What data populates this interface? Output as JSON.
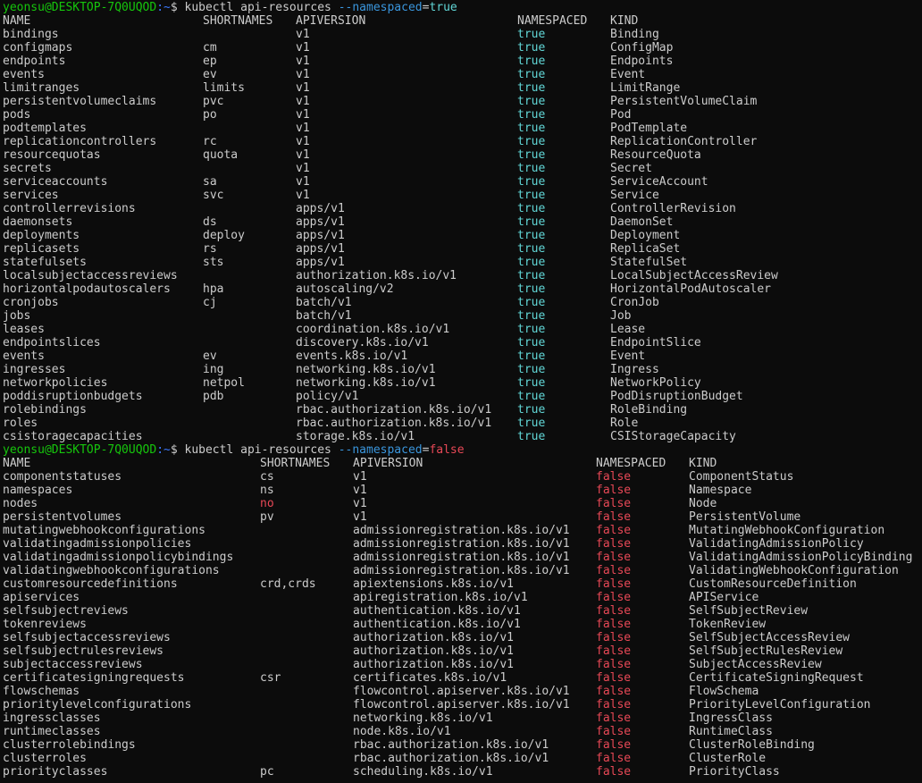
{
  "colors": {
    "green": "#16c60c",
    "red": "#e74856",
    "blue": "#3b78ff",
    "text": "#cccccc",
    "bg": "#0c0c0c"
  },
  "block1": {
    "prompt_user": "yeonsu@DESKTOP-7Q0UQOD",
    "prompt_path": ":~",
    "prompt_symbol": "$ ",
    "command": "kubectl api-resources ",
    "flag": "--namespaced",
    "flag_eq": "=",
    "flag_value": "true",
    "headers": [
      "NAME",
      "SHORTNAMES",
      "APIVERSION",
      "NAMESPACED",
      "KIND"
    ],
    "rows": [
      [
        "bindings",
        "",
        "v1",
        "true",
        "Binding"
      ],
      [
        "configmaps",
        "cm",
        "v1",
        "true",
        "ConfigMap"
      ],
      [
        "endpoints",
        "ep",
        "v1",
        "true",
        "Endpoints"
      ],
      [
        "events",
        "ev",
        "v1",
        "true",
        "Event"
      ],
      [
        "limitranges",
        "limits",
        "v1",
        "true",
        "LimitRange"
      ],
      [
        "persistentvolumeclaims",
        "pvc",
        "v1",
        "true",
        "PersistentVolumeClaim"
      ],
      [
        "pods",
        "po",
        "v1",
        "true",
        "Pod"
      ],
      [
        "podtemplates",
        "",
        "v1",
        "true",
        "PodTemplate"
      ],
      [
        "replicationcontrollers",
        "rc",
        "v1",
        "true",
        "ReplicationController"
      ],
      [
        "resourcequotas",
        "quota",
        "v1",
        "true",
        "ResourceQuota"
      ],
      [
        "secrets",
        "",
        "v1",
        "true",
        "Secret"
      ],
      [
        "serviceaccounts",
        "sa",
        "v1",
        "true",
        "ServiceAccount"
      ],
      [
        "services",
        "svc",
        "v1",
        "true",
        "Service"
      ],
      [
        "controllerrevisions",
        "",
        "apps/v1",
        "true",
        "ControllerRevision"
      ],
      [
        "daemonsets",
        "ds",
        "apps/v1",
        "true",
        "DaemonSet"
      ],
      [
        "deployments",
        "deploy",
        "apps/v1",
        "true",
        "Deployment"
      ],
      [
        "replicasets",
        "rs",
        "apps/v1",
        "true",
        "ReplicaSet"
      ],
      [
        "statefulsets",
        "sts",
        "apps/v1",
        "true",
        "StatefulSet"
      ],
      [
        "localsubjectaccessreviews",
        "",
        "authorization.k8s.io/v1",
        "true",
        "LocalSubjectAccessReview"
      ],
      [
        "horizontalpodautoscalers",
        "hpa",
        "autoscaling/v2",
        "true",
        "HorizontalPodAutoscaler"
      ],
      [
        "cronjobs",
        "cj",
        "batch/v1",
        "true",
        "CronJob"
      ],
      [
        "jobs",
        "",
        "batch/v1",
        "true",
        "Job"
      ],
      [
        "leases",
        "",
        "coordination.k8s.io/v1",
        "true",
        "Lease"
      ],
      [
        "endpointslices",
        "",
        "discovery.k8s.io/v1",
        "true",
        "EndpointSlice"
      ],
      [
        "events",
        "ev",
        "events.k8s.io/v1",
        "true",
        "Event"
      ],
      [
        "ingresses",
        "ing",
        "networking.k8s.io/v1",
        "true",
        "Ingress"
      ],
      [
        "networkpolicies",
        "netpol",
        "networking.k8s.io/v1",
        "true",
        "NetworkPolicy"
      ],
      [
        "poddisruptionbudgets",
        "pdb",
        "policy/v1",
        "true",
        "PodDisruptionBudget"
      ],
      [
        "rolebindings",
        "",
        "rbac.authorization.k8s.io/v1",
        "true",
        "RoleBinding"
      ],
      [
        "roles",
        "",
        "rbac.authorization.k8s.io/v1",
        "true",
        "Role"
      ],
      [
        "csistoragecapacities",
        "",
        "storage.k8s.io/v1",
        "true",
        "CSIStorageCapacity"
      ]
    ]
  },
  "block2": {
    "prompt_user": "yeonsu@DESKTOP-7Q0UQOD",
    "prompt_path": ":~",
    "prompt_symbol": "$ ",
    "command": "kubectl api-resources ",
    "flag": "--namespaced",
    "flag_eq": "=",
    "flag_value": "false",
    "headers": [
      "NAME",
      "SHORTNAMES",
      "APIVERSION",
      "NAMESPACED",
      "KIND"
    ],
    "rows": [
      [
        "componentstatuses",
        "cs",
        "v1",
        "false",
        "ComponentStatus"
      ],
      [
        "namespaces",
        "ns",
        "v1",
        "false",
        "Namespace"
      ],
      [
        "nodes",
        "no",
        "v1",
        "false",
        "Node"
      ],
      [
        "persistentvolumes",
        "pv",
        "v1",
        "false",
        "PersistentVolume"
      ],
      [
        "mutatingwebhookconfigurations",
        "",
        "admissionregistration.k8s.io/v1",
        "false",
        "MutatingWebhookConfiguration"
      ],
      [
        "validatingadmissionpolicies",
        "",
        "admissionregistration.k8s.io/v1",
        "false",
        "ValidatingAdmissionPolicy"
      ],
      [
        "validatingadmissionpolicybindings",
        "",
        "admissionregistration.k8s.io/v1",
        "false",
        "ValidatingAdmissionPolicyBinding"
      ],
      [
        "validatingwebhookconfigurations",
        "",
        "admissionregistration.k8s.io/v1",
        "false",
        "ValidatingWebhookConfiguration"
      ],
      [
        "customresourcedefinitions",
        "crd,crds",
        "apiextensions.k8s.io/v1",
        "false",
        "CustomResourceDefinition"
      ],
      [
        "apiservices",
        "",
        "apiregistration.k8s.io/v1",
        "false",
        "APIService"
      ],
      [
        "selfsubjectreviews",
        "",
        "authentication.k8s.io/v1",
        "false",
        "SelfSubjectReview"
      ],
      [
        "tokenreviews",
        "",
        "authentication.k8s.io/v1",
        "false",
        "TokenReview"
      ],
      [
        "selfsubjectaccessreviews",
        "",
        "authorization.k8s.io/v1",
        "false",
        "SelfSubjectAccessReview"
      ],
      [
        "selfsubjectrulesreviews",
        "",
        "authorization.k8s.io/v1",
        "false",
        "SelfSubjectRulesReview"
      ],
      [
        "subjectaccessreviews",
        "",
        "authorization.k8s.io/v1",
        "false",
        "SubjectAccessReview"
      ],
      [
        "certificatesigningrequests",
        "csr",
        "certificates.k8s.io/v1",
        "false",
        "CertificateSigningRequest"
      ],
      [
        "flowschemas",
        "",
        "flowcontrol.apiserver.k8s.io/v1",
        "false",
        "FlowSchema"
      ],
      [
        "prioritylevelconfigurations",
        "",
        "flowcontrol.apiserver.k8s.io/v1",
        "false",
        "PriorityLevelConfiguration"
      ],
      [
        "ingressclasses",
        "",
        "networking.k8s.io/v1",
        "false",
        "IngressClass"
      ],
      [
        "runtimeclasses",
        "",
        "node.k8s.io/v1",
        "false",
        "RuntimeClass"
      ],
      [
        "clusterrolebindings",
        "",
        "rbac.authorization.k8s.io/v1",
        "false",
        "ClusterRoleBinding"
      ],
      [
        "clusterroles",
        "",
        "rbac.authorization.k8s.io/v1",
        "false",
        "ClusterRole"
      ],
      [
        "priorityclasses",
        "pc",
        "scheduling.k8s.io/v1",
        "false",
        "PriorityClass"
      ]
    ]
  }
}
